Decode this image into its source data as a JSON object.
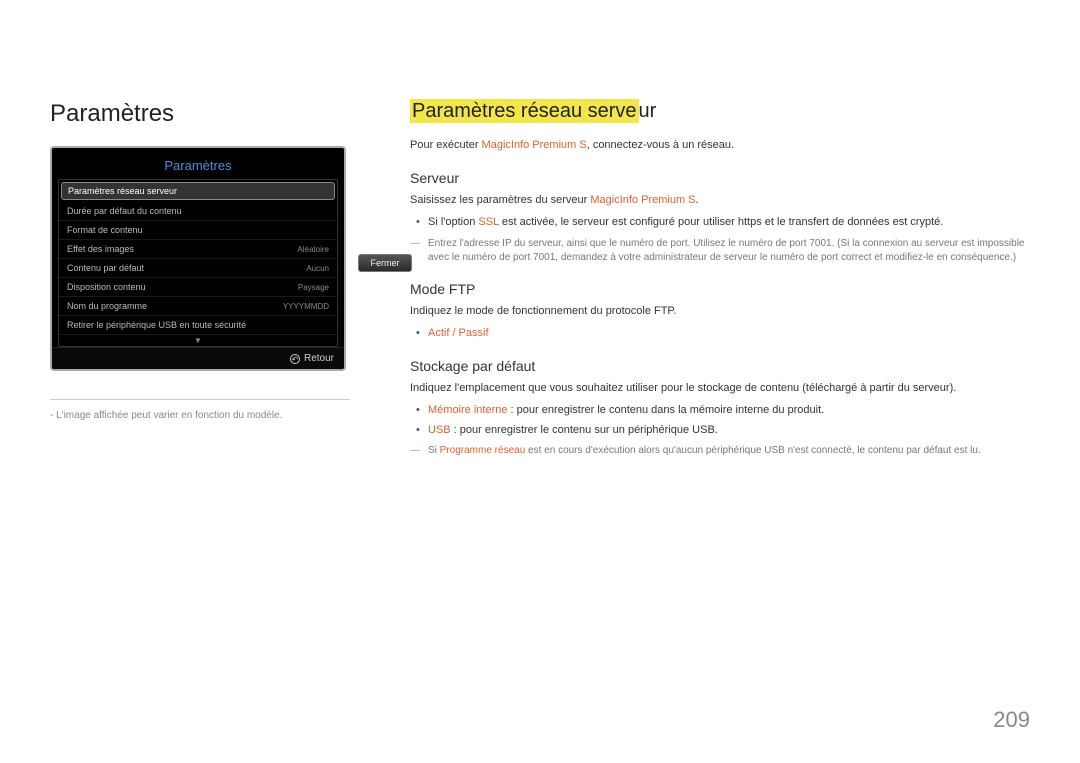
{
  "page_number": "209",
  "left": {
    "heading": "Paramètres",
    "osd": {
      "title": "Paramètres",
      "rows": [
        {
          "label": "Paramètres réseau serveur",
          "value": "",
          "selected": true
        },
        {
          "label": "Durée par défaut du contenu",
          "value": ""
        },
        {
          "label": "Format de contenu",
          "value": ""
        },
        {
          "label": "Effet des images",
          "value": "Aléatoire"
        },
        {
          "label": "Contenu par défaut",
          "value": "Aucun"
        },
        {
          "label": "Disposition contenu",
          "value": "Paysage"
        },
        {
          "label": "Nom du programme",
          "value": "YYYYMMDD"
        },
        {
          "label": "Retirer le périphérique USB en toute sécurité",
          "value": ""
        }
      ],
      "arrow": "▼",
      "close": "Fermer",
      "return_label": "Retour"
    },
    "caption": "L'image affichée peut varier en fonction du modèle."
  },
  "right": {
    "title_hl": "Paramètres réseau serve",
    "title_rest": "ur",
    "intro_pre": "Pour exécuter ",
    "intro_red": "MagicInfo Premium S",
    "intro_post": ", connectez-vous à un réseau.",
    "server": {
      "heading": "Serveur",
      "line_pre": "Saisissez les paramètres du serveur ",
      "line_red": "MagicInfo Premium S",
      "line_post": ".",
      "bullet_pre": "Si l'option ",
      "bullet_red": "SSL",
      "bullet_post": " est activée, le serveur est configuré pour utiliser https et le transfert de données est crypté.",
      "note": "Entrez l'adresse IP du serveur, ainsi que le numéro de port. Utilisez le numéro de port 7001. (Si la connexion au serveur est impossible avec le numéro de port 7001, demandez à votre administrateur de serveur le numéro de port correct et modifiez-le en conséquence.)"
    },
    "ftp": {
      "heading": "Mode FTP",
      "line": "Indiquez le mode de fonctionnement du protocole FTP.",
      "option": "Actif / Passif"
    },
    "storage": {
      "heading": "Stockage par défaut",
      "line": "Indiquez l'emplacement que vous souhaitez utiliser pour le stockage de contenu (téléchargé à partir du serveur).",
      "b1_red": "Mémoire interne",
      "b1_rest": " : pour enregistrer le contenu dans la mémoire interne du produit.",
      "b2_red": "USB",
      "b2_rest": " : pour enregistrer le contenu sur un périphérique USB.",
      "note_pre": "Si ",
      "note_red": "Programme réseau",
      "note_post": " est en cours d'exécution alors qu'aucun périphérique USB n'est connecté, le contenu par défaut est lu."
    }
  }
}
